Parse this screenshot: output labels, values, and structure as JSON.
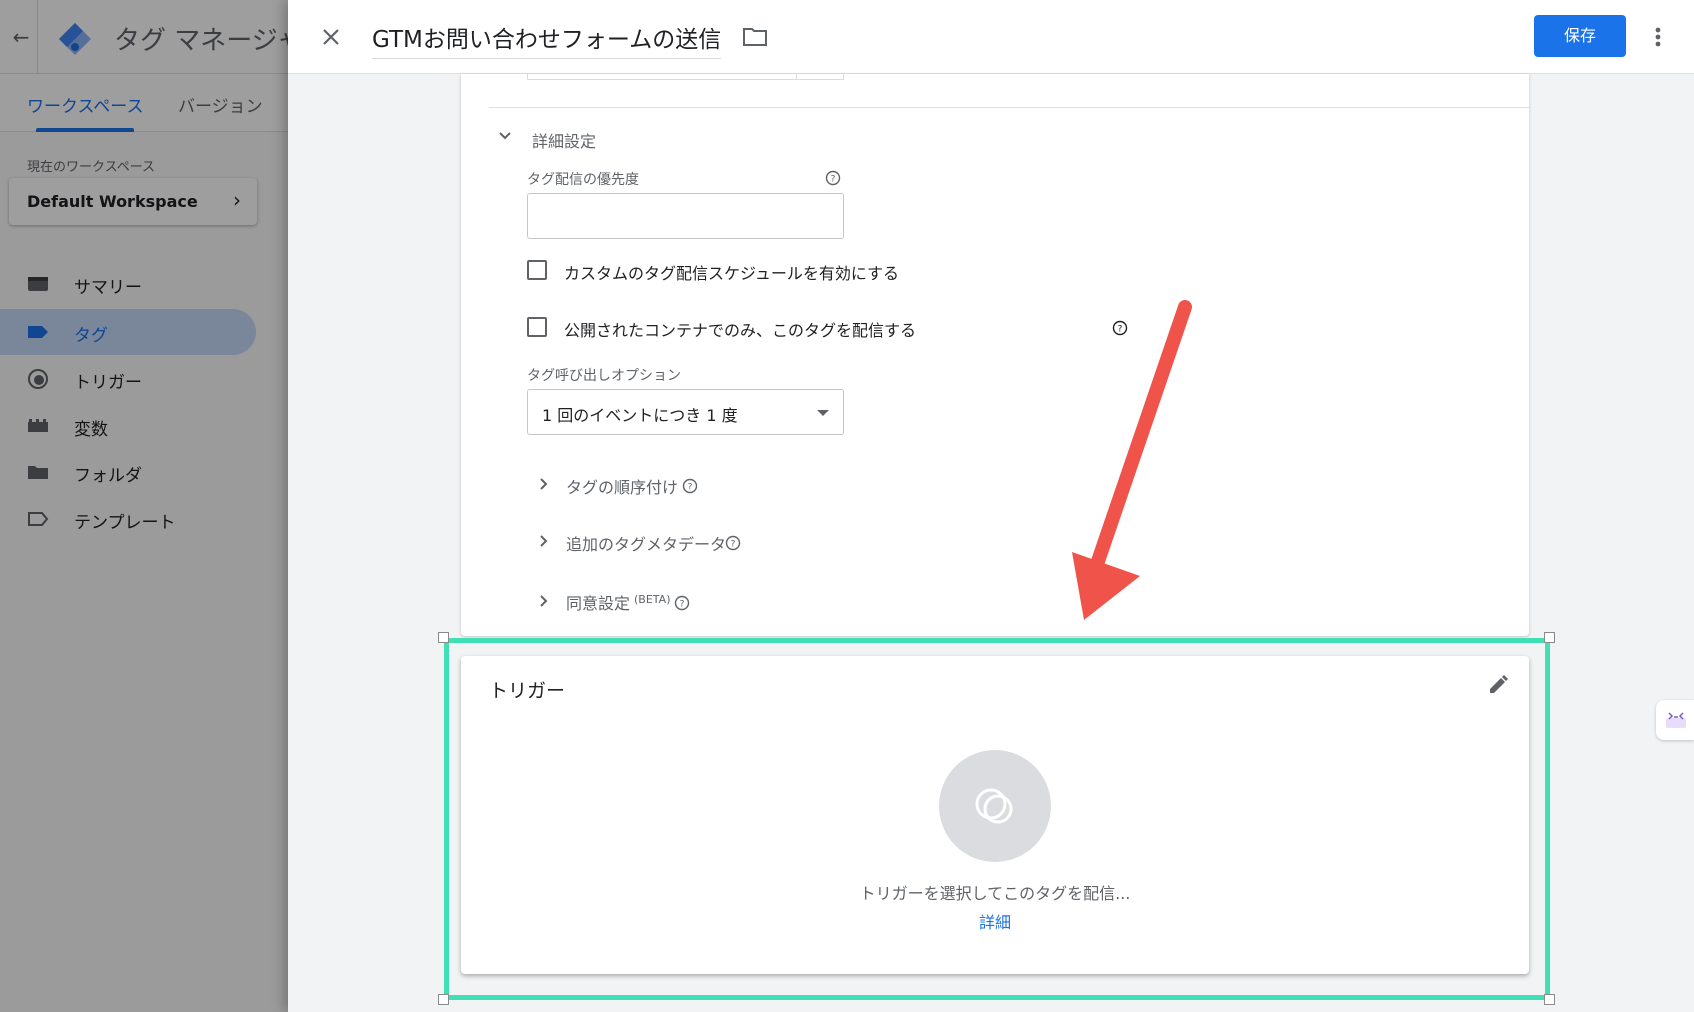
{
  "app": {
    "title": "タグ マネージャ",
    "tabs": [
      {
        "label": "ワークスペース",
        "active": true
      },
      {
        "label": "バージョン",
        "active": false
      }
    ],
    "workspace": {
      "label": "現在のワークスペース",
      "name": "Default Workspace"
    },
    "nav": [
      {
        "label": "サマリー",
        "icon": "summary-icon",
        "active": false
      },
      {
        "label": "タグ",
        "icon": "tag-icon",
        "active": true
      },
      {
        "label": "トリガー",
        "icon": "trigger-icon",
        "active": false
      },
      {
        "label": "変数",
        "icon": "variables-icon",
        "active": false
      },
      {
        "label": "フォルダ",
        "icon": "folder-icon",
        "active": false
      },
      {
        "label": "テンプレート",
        "icon": "template-icon",
        "active": false
      }
    ]
  },
  "editor": {
    "tag_name": "GTMお問い合わせフォームの送信",
    "save_label": "保存",
    "advanced": {
      "section_label": "詳細設定",
      "priority_label": "タグ配信の優先度",
      "priority_value": "",
      "custom_schedule_label": "カスタムのタグ配信スケジュールを有効にする",
      "custom_schedule_checked": false,
      "published_only_label": "公開されたコンテナでのみ、このタグを配信する",
      "published_only_checked": false,
      "firing_option_label": "タグ呼び出しオプション",
      "firing_option_value": "1 回のイベントにつき 1 度",
      "sequencing_label": "タグの順序付け",
      "metadata_label": "追加のタグメタデータ",
      "consent_label": "同意設定",
      "consent_badge": "(BETA)"
    },
    "trigger": {
      "title": "トリガー",
      "empty_text": "トリガーを選択してこのタグを配信...",
      "learn_more": "詳細"
    }
  },
  "colors": {
    "primary": "#1a73e8",
    "highlight": "#40e0b5",
    "arrow": "#f0534a"
  }
}
